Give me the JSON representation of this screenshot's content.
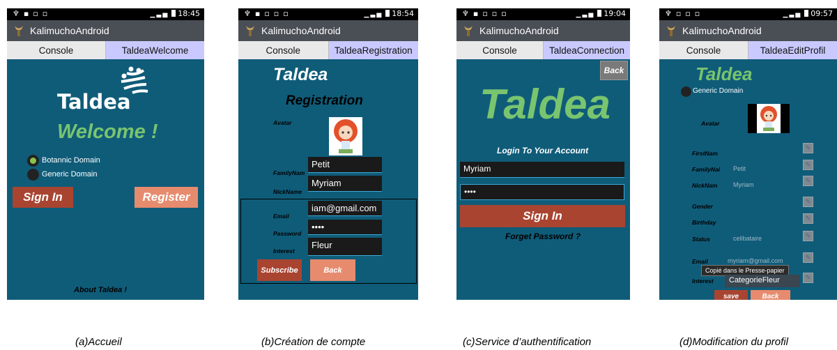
{
  "app_title": "KalimuchoAndroid",
  "screens": [
    {
      "time": "18:45",
      "tabs": [
        "Console",
        "TaldeaWelcome"
      ],
      "logo_text": "Taldea",
      "welcome": "Welcome !",
      "radio_botanic": "Botannic Domain",
      "radio_generic": "Generic Domain",
      "signin": "Sign In",
      "register": "Register",
      "about": "About Taldea !",
      "caption": "(a)Accueil"
    },
    {
      "time": "18:54",
      "tabs": [
        "Console",
        "TaldeaRegistration"
      ],
      "taldea": "Taldea",
      "heading": "Registration",
      "avatar_label": "Avatar",
      "familyname_label": "FamilyNam",
      "familyname_value": "Petit",
      "nickname_label": "NickName",
      "nickname_value": "Myriam",
      "email_label": "Email",
      "email_value": "iam@gmail.com",
      "password_label": "Password",
      "password_value": "••••",
      "interest_label": "Interest",
      "interest_value": "Fleur",
      "subscribe": "Subscribe",
      "back": "Back",
      "caption": "(b)Création de compte"
    },
    {
      "time": "19:04",
      "tabs": [
        "Console",
        "TaldeaConnection"
      ],
      "back": "Back",
      "taldea": "Taldea",
      "login_heading": "Login To Your Account",
      "username_value": "Myriam",
      "password_value": "••••",
      "signin": "Sign In",
      "forget": "Forget Password ?",
      "caption": "(c)Service d’authentification"
    },
    {
      "time": "09:57",
      "tabs": [
        "Console",
        "TaldeaEditProfil"
      ],
      "taldea": "Taldea",
      "radio_generic": "Generic Domain",
      "avatar_label": "Avatar",
      "firstname_label": "FirstNam",
      "familyname_label": "FamilyNai",
      "familyname_value": "Petit",
      "nickname_label": "NickNam",
      "nickname_value": "Myriam",
      "gender_label": "Gender",
      "birthday_label": "Birthday",
      "status_label": "Status",
      "status_value": "celibataire",
      "email_label": "Email",
      "email_value": "myriam@gmail.com",
      "toast": "Copié dans le Presse-papier",
      "interest_label": "Interest",
      "interest_value": "CategorieFleur",
      "save": "save",
      "back": "Back",
      "caption": "(d)Modification du profil"
    }
  ]
}
